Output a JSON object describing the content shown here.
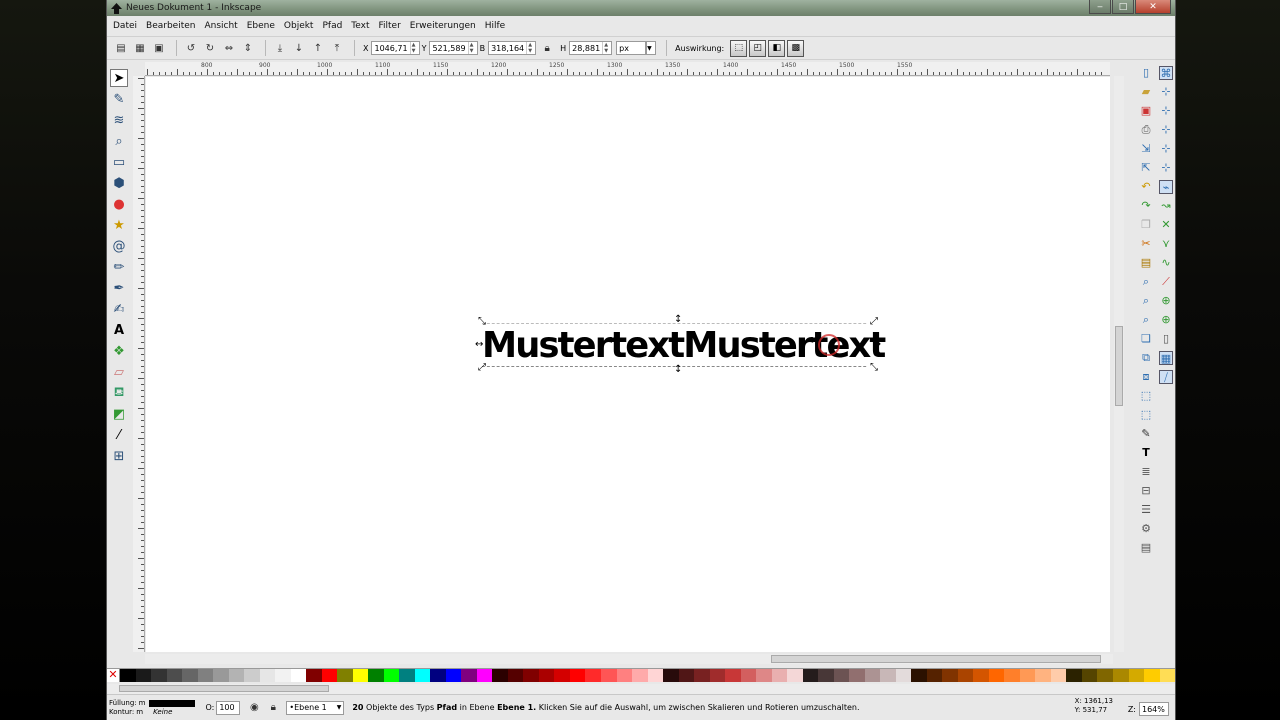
{
  "window": {
    "title": "Neues Dokument 1 - Inkscape"
  },
  "menu": [
    "Datei",
    "Bearbeiten",
    "Ansicht",
    "Ebene",
    "Objekt",
    "Pfad",
    "Text",
    "Filter",
    "Erweiterungen",
    "Hilfe"
  ],
  "controls": {
    "x_label": "X",
    "x_value": "1046,71",
    "y_label": "Y",
    "y_value": "521,589",
    "w_label": "B",
    "w_value": "318,164",
    "h_label": "H",
    "h_value": "28,881",
    "unit": "px",
    "transform_label": "Auswirkung:"
  },
  "hruler_ticks": [
    "800",
    "900",
    "1000",
    "1100",
    "1150",
    "1200",
    "1250",
    "1300",
    "1350",
    "1400",
    "1450",
    "1500",
    "1550"
  ],
  "canvas": {
    "text": "MustertextMustertext"
  },
  "palette_colors": [
    "#000000",
    "#1a1a1a",
    "#333333",
    "#4d4d4d",
    "#666666",
    "#808080",
    "#999999",
    "#b3b3b3",
    "#cccccc",
    "#e6e6e6",
    "#f2f2f2",
    "#ffffff",
    "#800000",
    "#ff0000",
    "#808000",
    "#ffff00",
    "#008000",
    "#00ff00",
    "#008080",
    "#00ffff",
    "#000080",
    "#0000ff",
    "#800080",
    "#ff00ff",
    "#2b0000",
    "#550000",
    "#800000",
    "#aa0000",
    "#d40000",
    "#ff0000",
    "#ff2a2a",
    "#ff5555",
    "#ff8080",
    "#ffaaaa",
    "#ffd5d5",
    "#280b0b",
    "#501616",
    "#782121",
    "#a02c2c",
    "#c83737",
    "#d35f5f",
    "#de8787",
    "#e9afaf",
    "#f4d7d7",
    "#241c1c",
    "#483737",
    "#6c5353",
    "#916f6f",
    "#ac9393",
    "#c8b7b7",
    "#e3dbdb",
    "#2b1100",
    "#552200",
    "#803300",
    "#aa4400",
    "#d45500",
    "#ff6600",
    "#ff7f2a",
    "#ff9955",
    "#ffb380",
    "#ffccaa",
    "#2b2200",
    "#554400",
    "#806600",
    "#aa8800",
    "#d4aa00",
    "#ffcc00",
    "#ffdd55"
  ],
  "status": {
    "fill_label": "Füllung:",
    "fill_value": "m",
    "stroke_label": "Kontur:",
    "stroke_value": "m",
    "stroke_none": "Keine",
    "opacity_label": "O:",
    "opacity_value": "100",
    "layer": "•Ebene 1",
    "message_count": "20",
    "message_pre": " Objekte des Typs ",
    "message_type": "Pfad",
    "message_mid": " in Ebene ",
    "message_layer": "Ebene 1.",
    "message_post": " Klicken Sie auf die Auswahl, um zwischen Skalieren und Rotieren umzuschalten.",
    "coord_x": "X: 1361,13",
    "coord_y": "Y:  531,77",
    "zoom_label": "Z:",
    "zoom_value": "164%"
  }
}
